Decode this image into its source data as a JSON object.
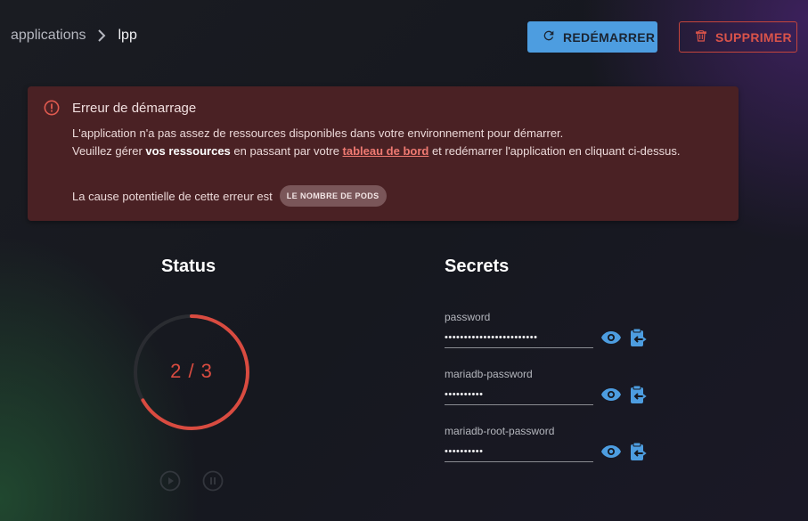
{
  "breadcrumb": {
    "parent": "applications",
    "current": "lpp"
  },
  "toolbar": {
    "restart_label": "REDÉMARRER",
    "delete_label": "SUPPRIMER"
  },
  "alert": {
    "title": "Erreur de démarrage",
    "line1": "L'application n'a pas assez de ressources disponibles dans votre environnement pour démarrer.",
    "line2_a": "Veuillez gérer ",
    "line2_bold": "vos ressources",
    "line2_b": " en passant par votre ",
    "line2_link": "tableau de bord",
    "line2_c": " et redémarrer l'application en cliquant ci-dessus.",
    "cause_text": "La cause potentielle de cette erreur est",
    "cause_chip": "LE NOMBRE DE PODS"
  },
  "status": {
    "title": "Status",
    "label": "2 / 3",
    "ready": 2,
    "total": 3
  },
  "secrets": {
    "title": "Secrets",
    "items": [
      {
        "label": "password",
        "value": "••••••••••••••••••••••••"
      },
      {
        "label": "mariadb-password",
        "value": "••••••••••"
      },
      {
        "label": "mariadb-root-password",
        "value": "••••••••••"
      }
    ]
  },
  "colors": {
    "accent": "#4d9de0",
    "danger": "#d9534a",
    "alert_bg": "#4a2124",
    "ring_progress": "#d94b40",
    "icon_blue": "#4d9de0"
  },
  "icons": {
    "breadcrumb_separator": "chevron-right-icon",
    "restart": "refresh-icon",
    "delete": "trash-icon",
    "alert": "error-circle-icon",
    "reveal": "eye-icon",
    "copy": "clipboard-icon",
    "play": "play-icon",
    "pause": "pause-icon"
  }
}
